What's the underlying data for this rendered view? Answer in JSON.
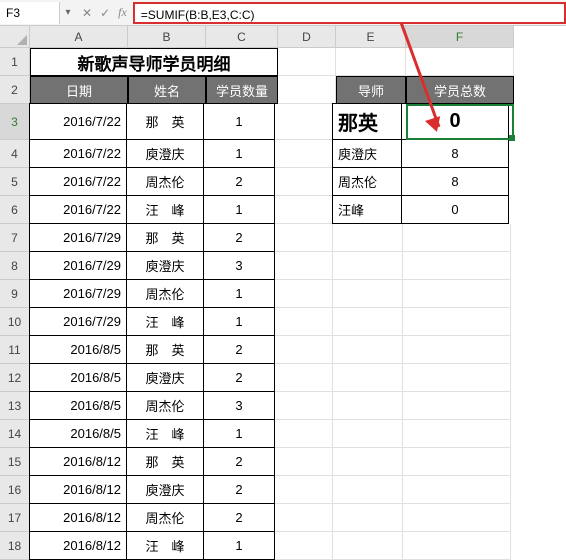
{
  "formula_bar": {
    "name_box": "F3",
    "formula": "=SUMIF(B:B,E3,C:C)"
  },
  "columns": [
    "A",
    "B",
    "C",
    "D",
    "E",
    "F"
  ],
  "row_numbers": [
    1,
    2,
    3,
    4,
    5,
    6,
    7,
    8,
    9,
    10,
    11,
    12,
    13,
    14,
    15,
    16,
    17,
    18
  ],
  "active_row": 3,
  "active_col": "F",
  "main_table": {
    "title": "新歌声导师学员明细",
    "headers": [
      "日期",
      "姓名",
      "学员数量"
    ],
    "rows": [
      {
        "date": "2016/7/22",
        "name": "那　英",
        "count": 1
      },
      {
        "date": "2016/7/22",
        "name": "庾澄庆",
        "count": 1
      },
      {
        "date": "2016/7/22",
        "name": "周杰伦",
        "count": 2
      },
      {
        "date": "2016/7/22",
        "name": "汪　峰",
        "count": 1
      },
      {
        "date": "2016/7/29",
        "name": "那　英",
        "count": 2
      },
      {
        "date": "2016/7/29",
        "name": "庾澄庆",
        "count": 3
      },
      {
        "date": "2016/7/29",
        "name": "周杰伦",
        "count": 1
      },
      {
        "date": "2016/7/29",
        "name": "汪　峰",
        "count": 1
      },
      {
        "date": "2016/8/5",
        "name": "那　英",
        "count": 2
      },
      {
        "date": "2016/8/5",
        "name": "庾澄庆",
        "count": 2
      },
      {
        "date": "2016/8/5",
        "name": "周杰伦",
        "count": 3
      },
      {
        "date": "2016/8/5",
        "name": "汪　峰",
        "count": 1
      },
      {
        "date": "2016/8/12",
        "name": "那　英",
        "count": 2
      },
      {
        "date": "2016/8/12",
        "name": "庾澄庆",
        "count": 2
      },
      {
        "date": "2016/8/12",
        "name": "周杰伦",
        "count": 2
      },
      {
        "date": "2016/8/12",
        "name": "汪　峰",
        "count": 1
      }
    ]
  },
  "summary_table": {
    "headers": [
      "导师",
      "学员总数"
    ],
    "rows": [
      {
        "name": "那英",
        "total": 0,
        "highlight": true
      },
      {
        "name": "庾澄庆",
        "total": 8
      },
      {
        "name": "周杰伦",
        "total": 8
      },
      {
        "name": "汪峰",
        "total": 0
      }
    ]
  }
}
